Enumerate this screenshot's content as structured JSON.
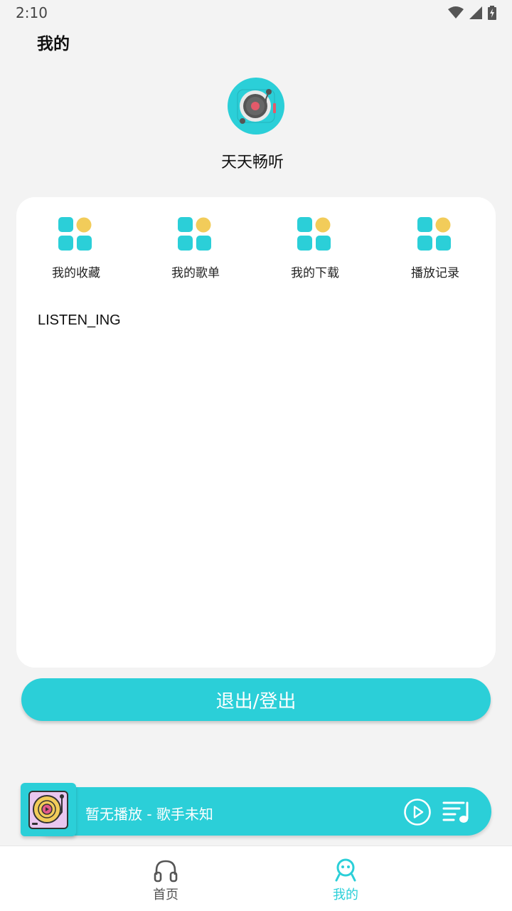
{
  "status_bar": {
    "time": "2:10",
    "icons": [
      "wifi-icon",
      "signal-icon",
      "battery-charging-icon"
    ]
  },
  "header": {
    "title": "我的"
  },
  "profile": {
    "app_name": "天天畅听",
    "logo_icon": "record-player-icon"
  },
  "menu": {
    "items": [
      {
        "label": "我的收藏",
        "icon": "grid-icon"
      },
      {
        "label": "我的歌单",
        "icon": "grid-icon"
      },
      {
        "label": "我的下载",
        "icon": "grid-icon"
      },
      {
        "label": "播放记录",
        "icon": "grid-icon"
      }
    ]
  },
  "listening": {
    "label": "LISTEN_ING"
  },
  "logout": {
    "label": "退出/登出"
  },
  "player": {
    "track_text": "暂无播放 - 歌手未知",
    "cover_icon": "turntable-icon"
  },
  "bottom_nav": {
    "tabs": [
      {
        "label": "首页",
        "icon": "headphones-icon",
        "active": false
      },
      {
        "label": "我的",
        "icon": "smiley-user-icon",
        "active": true
      }
    ]
  },
  "colors": {
    "accent": "#2bcfd8",
    "tile_teal": "#2bcfd8",
    "tile_yellow": "#f2cc5a",
    "inactive_tab": "#555555",
    "background": "#f3f3f3"
  }
}
